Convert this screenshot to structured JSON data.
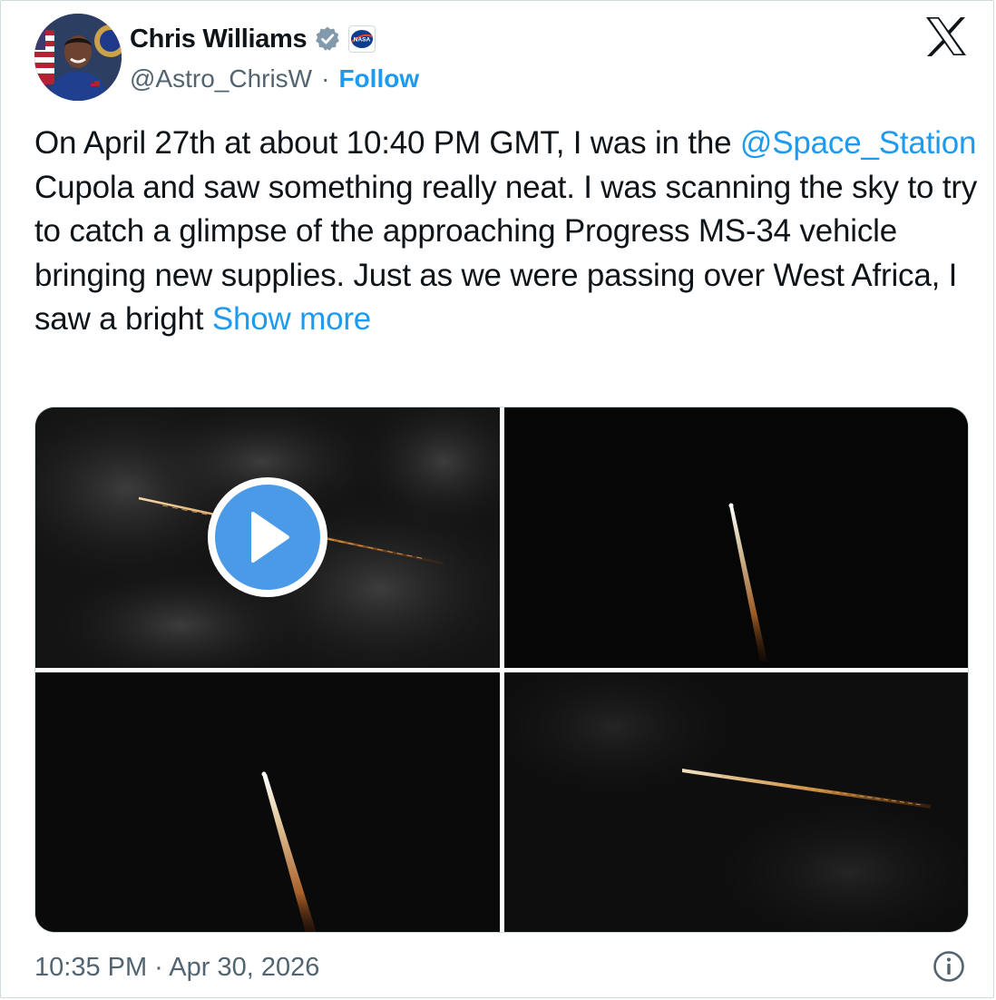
{
  "author": {
    "display_name": "Chris Williams",
    "handle": "@Astro_ChrisW",
    "separator": "·",
    "follow_label": "Follow",
    "verified_icon": "verified-badge-icon",
    "affiliation_icon": "nasa-logo-icon",
    "affiliation_badge_text": "NASA"
  },
  "platform_logo": "x-logo-icon",
  "tweet": {
    "text_part1": "On April 27th at about 10:40 PM GMT, I was in the ",
    "mention": "@Space_Station",
    "text_part2": " Cupola and saw something really neat.  I was scanning the sky to try to catch a glimpse of the approaching Progress MS-34 vehicle bringing new supplies. Just as we were passing over West Africa, I saw a bright ",
    "show_more_label": "Show more"
  },
  "media": {
    "tile_count": 4,
    "first_tile_is_video": true,
    "play_icon": "play-icon"
  },
  "footer": {
    "timestamp": "10:35 PM · Apr 30, 2026",
    "info_icon": "info-icon"
  },
  "colors": {
    "accent": "#1d9bf0",
    "text_primary": "#0f1419",
    "text_secondary": "#536471",
    "border": "#cfd9de",
    "play_button": "#4a9ae8"
  }
}
